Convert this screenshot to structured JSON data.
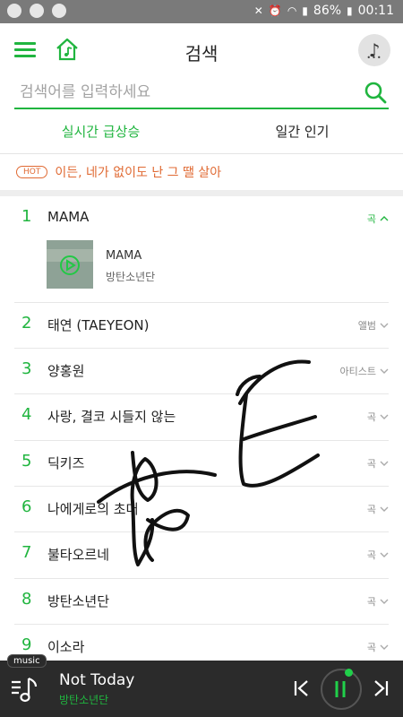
{
  "status_bar": {
    "battery": "86%",
    "time": "00:11"
  },
  "header": {
    "title": "검색",
    "menu_icon": "hamburger-icon",
    "home_icon": "home-icon",
    "music_icon": "music-note-icon"
  },
  "search": {
    "placeholder": "검색어를 입력하세요",
    "value": ""
  },
  "tabs": [
    {
      "label": "실시간 급상승",
      "active": true
    },
    {
      "label": "일간 인기",
      "active": false
    }
  ],
  "hot": {
    "badge": "HOT",
    "text": "이든, 네가 없이도 난 그 땔 살아"
  },
  "colors": {
    "accent": "#20b53f",
    "hot": "#e06a33",
    "player_bg": "#2b2b2b"
  },
  "list": [
    {
      "rank": "1",
      "name": "MAMA",
      "tag": "곡",
      "expanded": true
    },
    {
      "rank": "2",
      "name": "태연 (TAEYEON)",
      "tag": "앨범"
    },
    {
      "rank": "3",
      "name": "양홍원",
      "tag": "아티스트"
    },
    {
      "rank": "4",
      "name": "사랑, 결코 시들지 않는",
      "tag": "곡"
    },
    {
      "rank": "5",
      "name": "딕키즈",
      "tag": "곡"
    },
    {
      "rank": "6",
      "name": "나에게로의 초대",
      "tag": "곡"
    },
    {
      "rank": "7",
      "name": "불타오르네",
      "tag": "곡"
    },
    {
      "rank": "8",
      "name": "방탄소년단",
      "tag": "곡"
    },
    {
      "rank": "9",
      "name": "이소라",
      "tag": "곡"
    }
  ],
  "expanded_item": {
    "title": "MAMA",
    "artist": "방탄소년단"
  },
  "player": {
    "chip": "music",
    "title": "Not Today",
    "artist": "방탄소년단"
  }
}
